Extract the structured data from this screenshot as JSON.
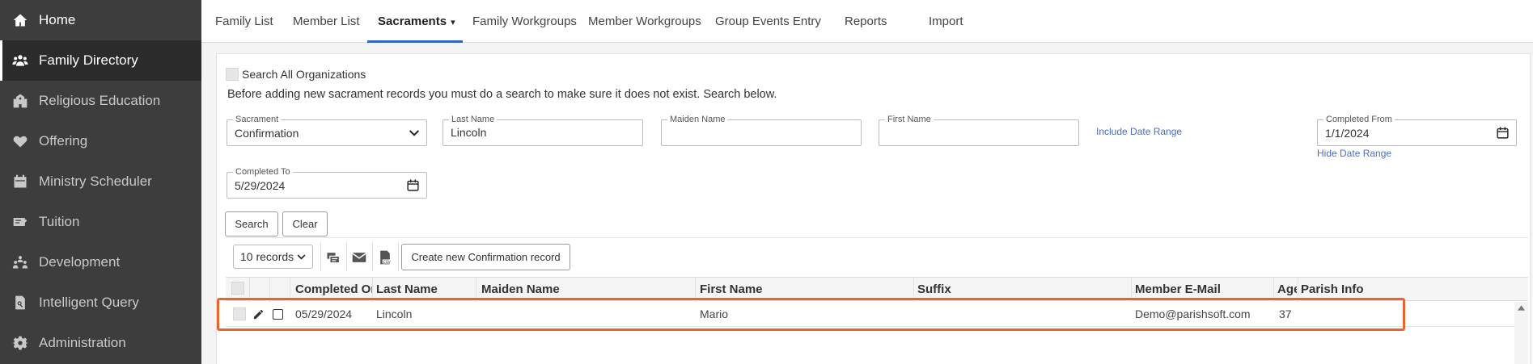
{
  "sidebar": {
    "items": [
      {
        "label": "Home",
        "icon": "home-icon"
      },
      {
        "label": "Family Directory",
        "icon": "users-icon"
      },
      {
        "label": "Religious Education",
        "icon": "school-icon"
      },
      {
        "label": "Offering",
        "icon": "heart-icon"
      },
      {
        "label": "Ministry Scheduler",
        "icon": "calendar-icon"
      },
      {
        "label": "Tuition",
        "icon": "ticket-icon"
      },
      {
        "label": "Development",
        "icon": "people-arch-icon"
      },
      {
        "label": "Intelligent Query",
        "icon": "search-doc-icon"
      },
      {
        "label": "Administration",
        "icon": "gear-icon"
      }
    ]
  },
  "topnav": {
    "tabs": [
      {
        "label": "Family List"
      },
      {
        "label": "Member List"
      },
      {
        "label": "Sacraments"
      },
      {
        "label": "Family Workgroups"
      },
      {
        "label": "Member Workgroups"
      },
      {
        "label": "Group Events Entry"
      },
      {
        "label": "Reports"
      },
      {
        "label": "Import"
      }
    ],
    "active_caret": "▾"
  },
  "search": {
    "all_orgs_label": "Search All Organizations",
    "instruction": "Before adding new sacrament records you must do a search to make sure it does not exist. Search below.",
    "sacrament": {
      "label": "Sacrament",
      "value": "Confirmation"
    },
    "last_name": {
      "label": "Last Name",
      "value": "Lincoln"
    },
    "maiden_name": {
      "label": "Maiden Name",
      "value": ""
    },
    "first_name": {
      "label": "First Name",
      "value": ""
    },
    "include_date_range": "Include Date Range",
    "completed_from": {
      "label": "Completed From",
      "value": "1/1/2024"
    },
    "hide_date_range": "Hide Date Range",
    "completed_to": {
      "label": "Completed To",
      "value": "5/29/2024"
    },
    "search_button": "Search",
    "clear_button": "Clear"
  },
  "grid": {
    "records_select": "10 records",
    "create_button": "Create new Confirmation record",
    "columns": [
      "Completed On",
      "Last Name",
      "Maiden Name",
      "First Name",
      "Suffix",
      "Member E-Mail",
      "Age",
      "Parish Info"
    ],
    "rows": [
      {
        "completed_on": "05/29/2024",
        "last_name": "Lincoln",
        "maiden_name": "",
        "first_name": "Mario",
        "suffix": "",
        "email": "Demo@parishsoft.com",
        "age": "37",
        "parish_info": ""
      }
    ]
  },
  "colors": {
    "sidebar_bg": "#3d3d3d",
    "active_tab_underline": "#2f63c4",
    "link": "#4a6fc1",
    "highlight": "#e8662e"
  }
}
